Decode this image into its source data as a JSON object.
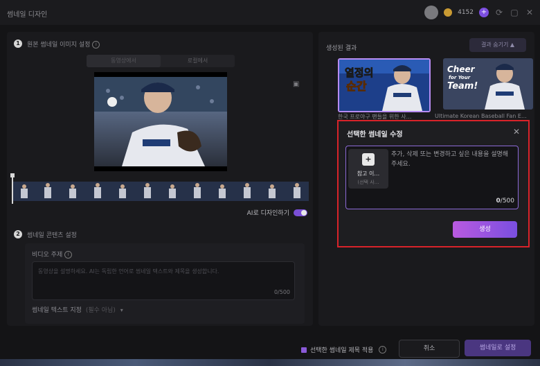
{
  "window": {
    "title": "썸네일 디자인",
    "credits": "4152"
  },
  "section1": {
    "number": "1",
    "title": "원본 썸네일 이미지 설정",
    "tabs": [
      "동영상에서",
      "로컬에서"
    ],
    "ai_design_label": "AI로 디자인하기",
    "ai_design_on": true
  },
  "section2": {
    "number": "2",
    "title": "썸네일 콘텐츠 설정",
    "video_topic_label": "비디오 주제",
    "video_topic_placeholder": "동영상을 설명하세요. AI는 독립한 언어로 썸네일 텍스트와 제목을 생성합니다.",
    "video_topic_count": "0/500",
    "text_style_label": "썸네일 텍스트 지정",
    "text_style_hint": "(필수 아님)"
  },
  "results": {
    "label": "생성된 결과",
    "hide_button": "결과 숨기기",
    "thumbnails": [
      {
        "caption": "한국 프로야구 팬들을 위한 사…",
        "overlay_text": "열정의 순간",
        "selected": true
      },
      {
        "caption": "Ultimate Korean Baseball Fan E…",
        "overlay_text": "Cheer for Your Team!",
        "selected": false
      }
    ]
  },
  "dialog": {
    "title": "선택한 썸네일 수정",
    "ref_label": "참고 이…",
    "ref_sub": "(선택 사…",
    "placeholder": "추가, 삭제 또는 변경하고 싶은 내용을 설명해 주세요.",
    "count_value": "0",
    "count_max": "/500",
    "generate_button": "생성"
  },
  "footer": {
    "apply_title_checkbox": "선택한 썸네일 제목 적용",
    "cancel_button": "취소",
    "apply_button": "썸네일로 설정"
  },
  "colors": {
    "accent": "#7a4fe0",
    "highlight_border": "#d9232a"
  }
}
